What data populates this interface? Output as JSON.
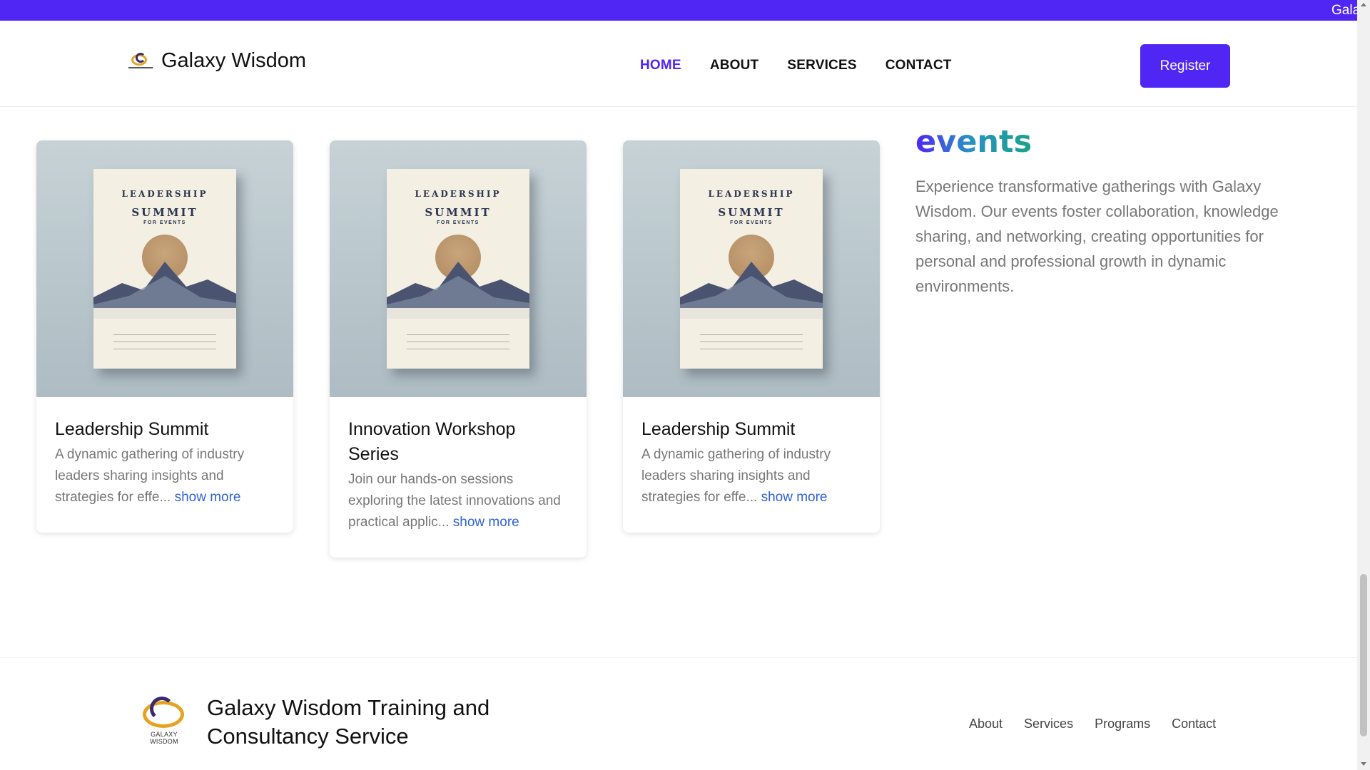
{
  "topbar": {
    "marquee_text": "Gala"
  },
  "header": {
    "brand_name": "Galaxy Wisdom",
    "nav": [
      {
        "label": "HOME",
        "active": true
      },
      {
        "label": "ABOUT",
        "active": false
      },
      {
        "label": "SERVICES",
        "active": false
      },
      {
        "label": "CONTACT",
        "active": false
      }
    ],
    "register_label": "Register"
  },
  "events": {
    "heading": "events",
    "description": "Experience transformative gatherings with Galaxy Wisdom. Our events foster collaboration, knowledge sharing, and networking, creating opportunities for personal and professional growth in dynamic environments.",
    "cards": [
      {
        "poster": {
          "line1": "LEADERSHIP",
          "line2": "SUMMIT",
          "line3": "FOR EVENTS"
        },
        "title": "Leadership Summit",
        "description": "A dynamic gathering of industry leaders sharing insights and strategies for effe...",
        "more_label": "show more"
      },
      {
        "poster": {
          "line1": "LEADERSHIP",
          "line2": "SUMMIT",
          "line3": "FOR EVENTS"
        },
        "title": "Innovation Workshop Series",
        "description": "Join our hands-on sessions exploring the latest innovations and practical applic...",
        "more_label": "show more"
      },
      {
        "poster": {
          "line1": "LEADERSHIP",
          "line2": "SUMMIT",
          "line3": "FOR EVENTS"
        },
        "title": "Leadership Summit",
        "description": "A dynamic gathering of industry leaders sharing insights and strategies for effe...",
        "more_label": "show more"
      }
    ]
  },
  "footer": {
    "logo_text": "GALAXY WISDOM",
    "title": "Galaxy Wisdom Training and Consultancy Service",
    "links": [
      "About",
      "Services",
      "Programs",
      "Contact"
    ]
  },
  "colors": {
    "accent": "#5026f5",
    "link": "#2f62d8",
    "muted_text": "#777777"
  }
}
